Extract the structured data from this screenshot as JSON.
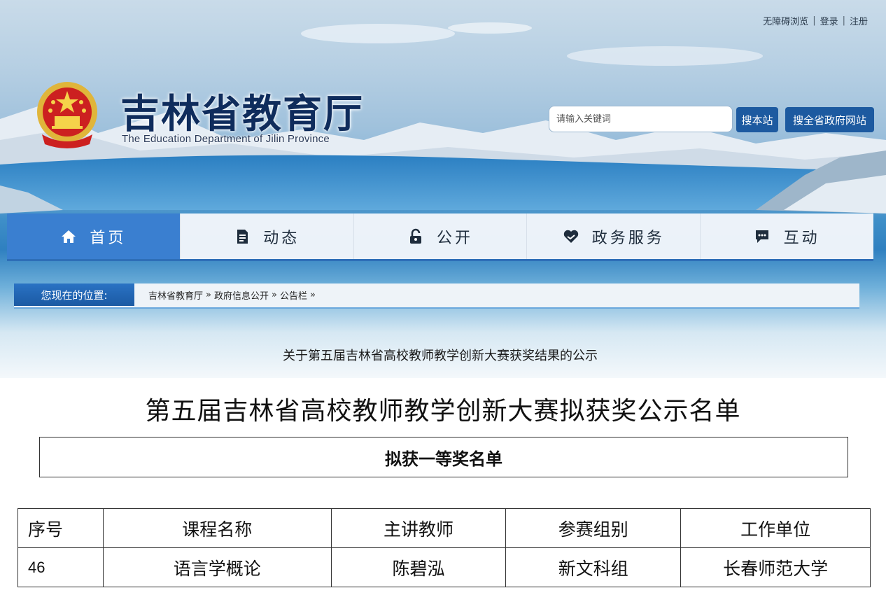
{
  "header": {
    "links": [
      "无障碍浏览",
      "登录",
      "注册"
    ],
    "site_title": "吉林省教育厅",
    "site_subtitle": "The Education Department of Jilin Province",
    "emblem_icon": "national-emblem-icon",
    "search": {
      "placeholder": "请输入关键词",
      "btn_local": "搜本站",
      "btn_all": "搜全省政府网站"
    }
  },
  "nav": {
    "items": [
      {
        "label": "首页",
        "icon": "home-icon",
        "active": true
      },
      {
        "label": "动态",
        "icon": "document-icon"
      },
      {
        "label": "公开",
        "icon": "unlock-icon"
      },
      {
        "label": "政务服务",
        "icon": "heart-hands-icon"
      },
      {
        "label": "互动",
        "icon": "chat-icon"
      }
    ]
  },
  "breadcrumb": {
    "label": "您现在的位置:",
    "path": [
      "吉林省教育厅",
      "政府信息公开",
      "公告栏"
    ],
    "separator": "»"
  },
  "notice": {
    "title": "关于第五届吉林省高校教师教学创新大赛获奖结果的公示"
  },
  "document": {
    "title": "第五届吉林省高校教师教学创新大赛拟获奖公示名单",
    "award_level": "拟获一等奖名单",
    "table": {
      "headers": [
        "序号",
        "课程名称",
        "主讲教师",
        "参赛组别",
        "工作单位"
      ],
      "rows": [
        [
          "46",
          "语言学概论",
          "陈碧泓",
          "新文科组",
          "长春师范大学"
        ]
      ]
    }
  },
  "colors": {
    "brand_blue": "#1d5aa0",
    "nav_active": "#3a7fd0",
    "title_navy": "#0f2c5c"
  }
}
